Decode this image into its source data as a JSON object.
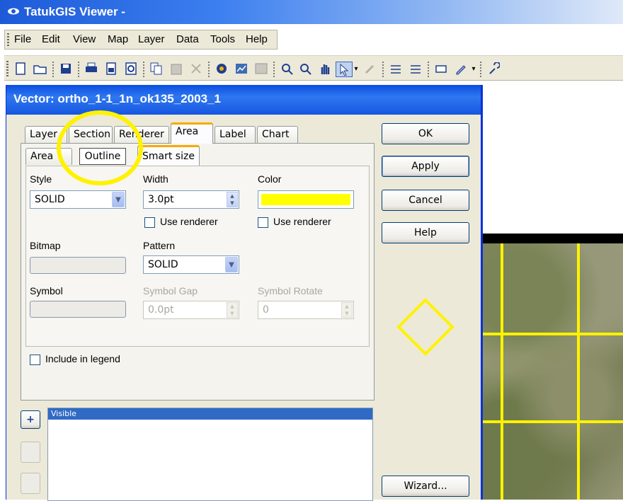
{
  "app": {
    "title": "TatukGIS Viewer -"
  },
  "menu": [
    "File",
    "Edit",
    "View",
    "Map",
    "Layer",
    "Data",
    "Tools",
    "Help"
  ],
  "toolbar": {
    "icons": [
      "new-icon",
      "open-icon",
      "save-icon",
      "print-icon",
      "print-preview-icon",
      "export-icon",
      "copy-icon",
      "paste-icon",
      "cut-icon",
      "layers-icon",
      "map-icon",
      "raster-icon",
      "zoom-in-icon",
      "zoom-icon",
      "pan-icon",
      "select-icon",
      "dropdown-icon",
      "edit-icon",
      "legend-icon",
      "legend2-icon",
      "attribute-icon",
      "pencil-icon",
      "dropdown2-icon",
      "tool-icon"
    ]
  },
  "dialog": {
    "title": "Vector: ortho_1-1_1n_ok135_2003_1",
    "tabs": [
      "Layer",
      "Section",
      "Renderer",
      "Area",
      "Label",
      "Chart"
    ],
    "active_tab": "Area",
    "subtabs": [
      "Area",
      "Outline",
      "Smart size"
    ],
    "active_subtab": "Outline",
    "style": {
      "label": "Style",
      "value": "SOLID"
    },
    "width": {
      "label": "Width",
      "value": "3.0pt"
    },
    "color": {
      "label": "Color",
      "value": "#ffff00"
    },
    "use_renderer_1": "Use renderer",
    "use_renderer_2": "Use renderer",
    "bitmap": {
      "label": "Bitmap"
    },
    "pattern": {
      "label": "Pattern",
      "value": "SOLID"
    },
    "symbol": {
      "label": "Symbol"
    },
    "symbol_gap": {
      "label": "Symbol Gap",
      "value": "0.0pt"
    },
    "symbol_rotate": {
      "label": "Symbol Rotate",
      "value": "0"
    },
    "include_legend": "Include in legend",
    "list_header": "Visible",
    "add_button": "+",
    "buttons": {
      "ok": "OK",
      "apply": "Apply",
      "cancel": "Cancel",
      "help": "Help",
      "wizard": "Wizard..."
    }
  },
  "highlight_color": "#ffff00"
}
